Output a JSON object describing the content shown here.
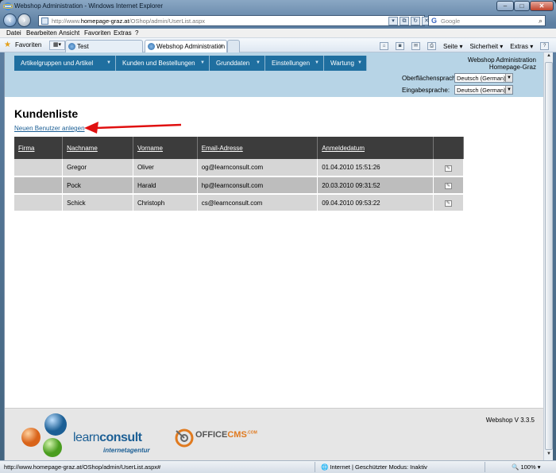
{
  "browser": {
    "window_title": "Webshop Administration - Windows Internet Explorer",
    "address_prefix": "http://www.",
    "address_host": "homepage-graz.at",
    "address_path": "/OShop/admin/UserList.aspx",
    "search_placeholder": "Google",
    "menu": [
      "Datei",
      "Bearbeiten",
      "Ansicht",
      "Favoriten",
      "Extras",
      "?"
    ],
    "favorites_label": "Favoriten",
    "tabs": [
      "Test",
      "Webshop Administration"
    ],
    "commands": [
      "Seite ▾",
      "Sicherheit ▾",
      "Extras ▾"
    ],
    "status_url": "http://www.homepage-graz.at/OShop/admin/UserList.aspx#",
    "status_zone": "Internet | Geschützter Modus: Inaktiv",
    "zoom": "100%"
  },
  "header": {
    "nav": [
      "Artikelgruppen und Artikel",
      "Kunden und Bestellungen",
      "Grunddaten",
      "Einstellungen",
      "Wartung"
    ],
    "admin_title": "Webshop Administration",
    "admin_subtitle": "Homepage-Graz",
    "ui_language_label": "Oberflächensprache:",
    "ui_language_value": "Deutsch (German)",
    "input_language_label": "Eingabesprache:",
    "input_language_value": "Deutsch (German)"
  },
  "page": {
    "title": "Kundenliste",
    "new_user_link": "Neuen Benutzer anlegen"
  },
  "table": {
    "columns": [
      "Firma",
      "Nachname",
      "Vorname",
      "Email-Adresse",
      "Anmeldedatum",
      ""
    ],
    "rows": [
      {
        "firma": "",
        "nachname": "Gregor",
        "vorname": "Oliver",
        "email": "og@learnconsult.com",
        "datum": "01.04.2010 15:51:26"
      },
      {
        "firma": "",
        "nachname": "Pock",
        "vorname": "Harald",
        "email": "hp@learnconsult.com",
        "datum": "20.03.2010 09:31:52"
      },
      {
        "firma": "",
        "nachname": "Schick",
        "vorname": "Christoph",
        "email": "cs@learnconsult.com",
        "datum": "09.04.2010 09:53:22"
      }
    ]
  },
  "footer": {
    "version": "Webshop V 3.3.5",
    "logo1_text_a": "learn",
    "logo1_text_b": "consult",
    "logo1_sub": "internetagentur",
    "logo2_text_a": "OFFICE",
    "logo2_text_b": "CMS",
    "logo2_text_c": ".COM"
  },
  "colors": {
    "header_bg": "#b7d4e6",
    "nav_bg": "#1f6fa0",
    "table_header_bg": "#3c3c3c",
    "row_odd": "#d6d6d6",
    "row_even": "#bdbdbd",
    "arrow": "#e01010"
  }
}
